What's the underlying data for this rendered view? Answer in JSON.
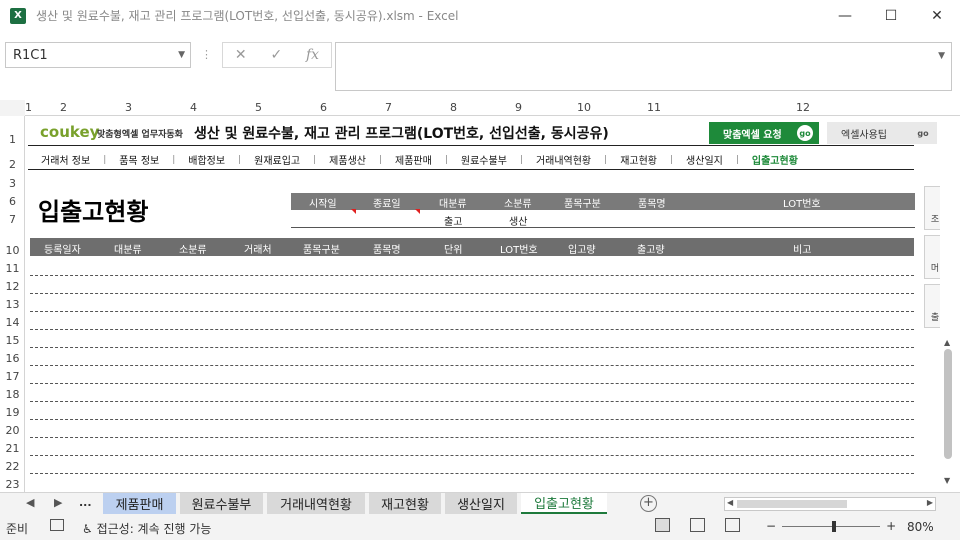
{
  "window": {
    "title": "생산 및 원료수불, 재고 관리 프로그램(LOT번호, 선입선출, 동시공유).xlsm  -  Excel",
    "app_icon": "excel-icon",
    "minimize": "—",
    "maximize": "☐",
    "close": "✕"
  },
  "formula_bar": {
    "name_box": "R1C1",
    "cancel": "✕",
    "enter": "✓",
    "fx": "fx",
    "value": ""
  },
  "columns": [
    "1",
    "2",
    "3",
    "4",
    "5",
    "6",
    "7",
    "8",
    "9",
    "10",
    "11",
    "12"
  ],
  "rows": [
    "1",
    "2",
    "3",
    "6",
    "7",
    "10",
    "11",
    "12",
    "13",
    "14",
    "15",
    "16",
    "17",
    "18",
    "19",
    "20",
    "21",
    "22",
    "23"
  ],
  "banner": {
    "logo": "coukey",
    "logo_sub": "맞춤형엑셀 업무자동화",
    "title": "생산 및 원료수불, 재고 관리 프로그램(LOT번호, 선입선출, 동시공유)",
    "btn_custom": "맞춤엑셀 요청",
    "btn_tips": "엑셀사용팁",
    "go": "go"
  },
  "nav": {
    "items": [
      {
        "label": "거래처 정보"
      },
      {
        "label": "품목 정보"
      },
      {
        "label": "배합정보"
      },
      {
        "label": "원재료입고"
      },
      {
        "label": "제품생산"
      },
      {
        "label": "제품판매"
      },
      {
        "label": "원료수불부"
      },
      {
        "label": "거래내역현황"
      },
      {
        "label": "재고현황"
      },
      {
        "label": "생산일지"
      },
      {
        "label": "입출고현황"
      }
    ]
  },
  "page_title": "입출고현황",
  "filter": {
    "headers": [
      "시작일",
      "종료일",
      "대분류",
      "소분류",
      "품목구분",
      "품목명",
      "LOT번호"
    ],
    "values": [
      "",
      "",
      "출고",
      "생산",
      "",
      "",
      ""
    ]
  },
  "table": {
    "headers": [
      "등록일자",
      "대분류",
      "소분류",
      "거래처",
      "품목구분",
      "품목명",
      "단위",
      "LOT번호",
      "입고량",
      "출고량",
      "비고"
    ]
  },
  "side_panel": [
    "조",
    "머",
    "출"
  ],
  "sheet_tabs": {
    "more": "...",
    "tabs": [
      "제품판매",
      "원료수불부",
      "거래내역현황",
      "재고현황",
      "생산일지",
      "입출고현황"
    ],
    "active": "입출고현황"
  },
  "status": {
    "ready": "준비",
    "accessibility": "접근성: 계속 진행 가능",
    "zoom": "80%",
    "minus": "−",
    "plus": "+"
  }
}
